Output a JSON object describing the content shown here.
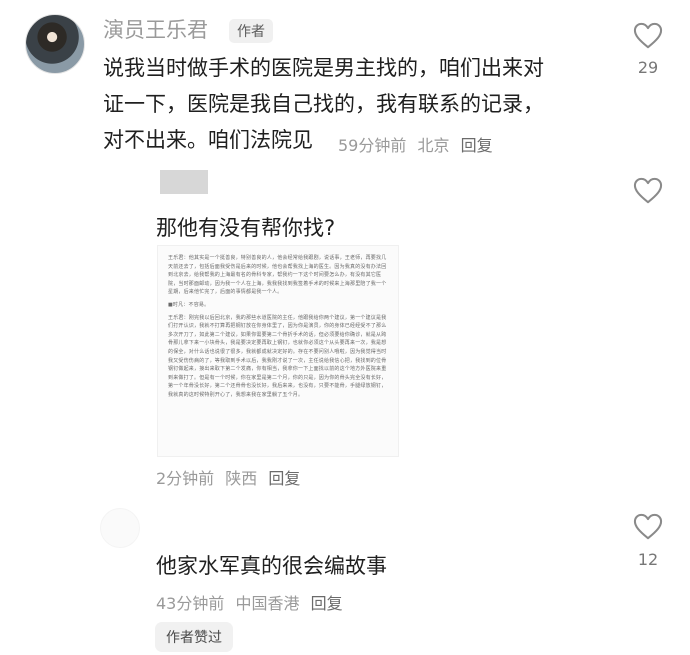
{
  "comment1": {
    "username": "演员王乐君",
    "author_tag": "作者",
    "lines": [
      "说我当时做手术的医院是男主找的，咱们出来对",
      "证一下，医院是我自己找的，我有联系的记录，",
      "对不出来。咱们法院见"
    ],
    "time": "59分钟前",
    "location": "北京",
    "reply_label": "回复",
    "like_count": "29"
  },
  "comment2": {
    "text": "那他有没有帮你找?",
    "doc_paragraphs": [
      "王乐君：他其实是一个挺善良，特别善良的人，他会经常给我跟剧，说话事，王老师，再要找几天前还去了，包括后面我受伤是后来的时候，他也会帮我找上海的医生。因为我真的没有办法回到北京去，给我帮我的上海最有名的骨科专家，帮我约一下这个时间要怎么办，有没有其它医院，当时那面邮动，因为我一个人在上海，我我我找到我签着手术的时候来上海那里陪了我一个星期，后来他忙完了，后面的事情都是我一个人。",
      "■时凡：不容易。",
      "王乐君：刚完我以后回北京，我的那些水道医院的主任，他跟我给你两个建议，第一个建议是我们打开认识，我就不打算再把钢钉放在你身体里了，因为你是演员，你的身体已经经受不了那么多次开刀了，如此第二个建议，如果你需要第二个骨折手术的话，但必须要给你确诊，就是从跨骨那儿拿下来一小块骨头，我是要决定要再取上钢钉，也就你必须这个从头要再来一次，我是想的保全，对什么话也说很了很多，我就都成就决定好的。存在不要问别人哦啦，因为我觉得当时我又受伤伤病的了，等我取到手术以后，我我刚才说了一次，主任说给我信心把，我找到的位骨钢钉做起来，接出来取下第二个发痛，你有相当，我拿你一下上面找以前的这个地方外医院来重到来做打了。但是有一个时候，你在家里是第二个月，你的只是，因为你的骨头完全没有长好，第一个年骨没长好，第二个还骨骨也没长好，我后来来，也没有，只要不能骨，手腿绿放钢钉，我就真的这时候特别开心了，我想来我在家里躺了五个月。"
    ],
    "time": "2分钟前",
    "location": "陕西",
    "reply_label": "回复"
  },
  "comment3": {
    "text": "他家水军真的很会编故事",
    "time": "43分钟前",
    "location": "中国香港",
    "reply_label": "回复",
    "like_count": "12",
    "author_liked": "作者赞过"
  }
}
